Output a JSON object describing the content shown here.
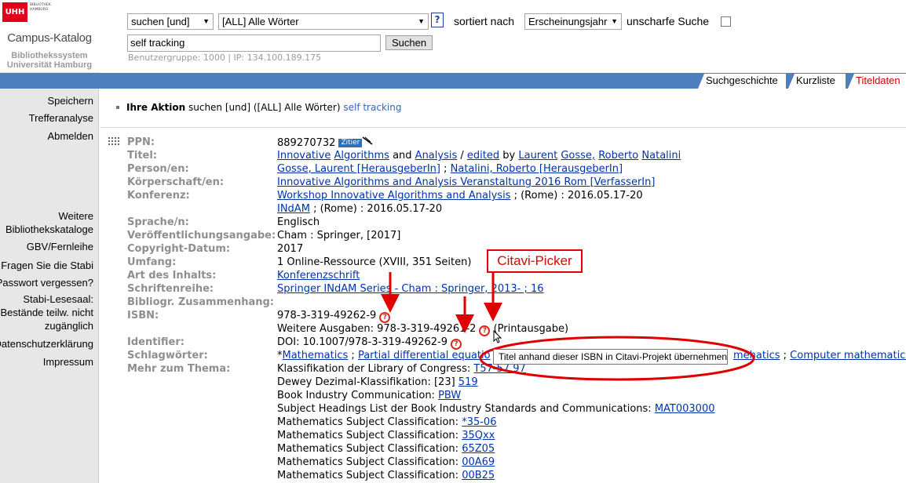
{
  "logo": {
    "mark": "UHH",
    "library_small": "BIBLIOTHEK HAMBURG",
    "title": "Campus-Katalog",
    "sub1": "Bibliothekssystem",
    "sub2": "Universität Hamburg"
  },
  "left_nav": {
    "save": "Speichern",
    "analysis": "Trefferanalyse",
    "logout": "Abmelden",
    "more_catalogs": "Weitere Bibliothekskataloge",
    "interlibrary": "GBV/Fernleihe",
    "ask": "Fragen Sie die Stabi",
    "forgot_password": "Passwort vergessen?",
    "reading_room": "Stabi-Lesesaal: Bestände teilw. nicht zugänglich",
    "privacy": "Datenschutzerklärung",
    "imprint": "Impressum"
  },
  "search": {
    "action_select": "suchen [und]",
    "field_select": "[ALL] Alle Wörter",
    "help": "?",
    "sort_label": "sortiert nach",
    "sort_select": "Erscheinungsjahr",
    "fuzzy_label": "unscharfe Suche",
    "fuzzy_checked": false,
    "query": "self tracking",
    "button": "Suchen",
    "user_info": "Benutzergruppe: 1000 | IP: 134.100.189.175"
  },
  "tabs": {
    "history": "Suchgeschichte",
    "shortlist": "Kurzliste",
    "details": "Titeldaten",
    "active": "details"
  },
  "action": {
    "label": "Ihre Aktion",
    "text": "suchen [und] ([ALL] Alle Wörter)",
    "query": "self tracking"
  },
  "record": {
    "labels": {
      "ppn": "PPN:",
      "title": "Titel:",
      "persons": "Person/en:",
      "corporate": "Körperschaft/en:",
      "conference": "Konferenz:",
      "language": "Sprache/n:",
      "publication": "Veröffentlichungsangabe:",
      "copyright": "Copyright-Datum:",
      "extent": "Umfang:",
      "content_type": "Art des Inhalts:",
      "series": "Schriftenreihe:",
      "bibliographic_context": "Bibliogr. Zusammenhang:",
      "isbn": "ISBN:",
      "identifier": "Identifier:",
      "subjects": "Schlagwörter:",
      "more_topic": "Mehr zum Thema:"
    },
    "ppn": "889270732",
    "cite_badge": "Zitier",
    "title_parts": {
      "w1": "Innovative",
      "w2": "Algorithms",
      "and": "and",
      "w3": "Analysis",
      "slash": "/",
      "edited": "edited",
      "by": "by",
      "p1a": "Laurent",
      "p1b": "Gosse,",
      "p2a": "Roberto",
      "p2b": "Natalini"
    },
    "person1": "Gosse, Laurent [HerausgeberIn]",
    "sep": ";",
    "person2": "Natalini, Roberto [HerausgeberIn]",
    "corporate": "Innovative Algorithms and Analysis Veranstaltung 2016 Rom [VerfasserIn]",
    "conference1_link": "Workshop Innovative Algorithms and Analysis",
    "conference1_rest": "; (Rome) : 2016.05.17-20",
    "conference2_link": "INdAM",
    "conference2_rest": "; (Rome) : 2016.05.17-20",
    "language": "Englisch",
    "publication": "Cham : Springer, [2017]",
    "copyright": "2017",
    "extent": "1 Online-Ressource (XVIII, 351 Seiten)",
    "content_type": "Konferenzschrift",
    "series": "Springer INdAM Series - Cham : Springer, 2013- ; 16",
    "isbn": "978-3-319-49262-9",
    "other_editions_label": "Weitere Ausgaben:",
    "other_editions_isbn": "978-3-319-49261-2",
    "other_editions_note": "(Printausgabe)",
    "doi": "DOI: 10.1007/978-3-319-49262-9",
    "subjects_prefix": "*",
    "subject1": "Mathematics",
    "subject2": "Partial differential equatio",
    "subject3": "mehatics",
    "subject4": "Computer mathematics",
    "lcc_label": "Klassifikation der Library of Congress:",
    "lcc_value": "T57-57.97",
    "ddc_label": "Dewey Dezimal-Klassifikation: [23]",
    "ddc_value": "519",
    "bic_label": "Book Industry Communication:",
    "bic_value": "PBW",
    "bisac_label": "Subject Headings List der Book Industry Standards and Communications:",
    "bisac_value": "MAT003000",
    "msc_label": "Mathematics Subject Classification:",
    "msc_values": [
      "*35-06",
      "35Qxx",
      "65Z05",
      "00A69",
      "00B25"
    ]
  },
  "annotation": {
    "label": "Citavi-Picker",
    "tooltip": "Titel anhand dieser ISBN in Citavi-Projekt übernehmen",
    "color": "#e00000"
  },
  "icons": {
    "citavi": "citavi-picker-icon",
    "cite": "cite-icon",
    "drag": "drag-handle-icon",
    "help": "help-icon"
  }
}
